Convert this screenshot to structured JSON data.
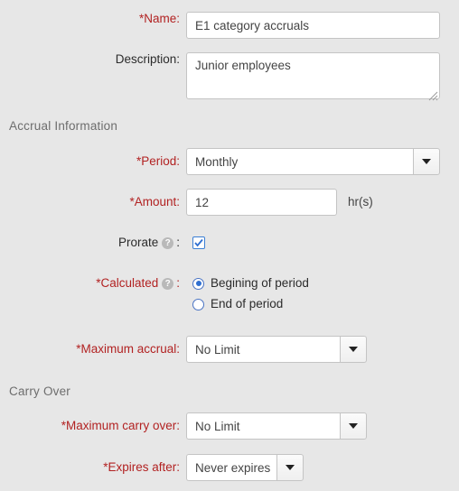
{
  "fields": {
    "name": {
      "label": "*Name:",
      "value": "E1 category accruals",
      "placeholder": ""
    },
    "description": {
      "label": "Description:",
      "value": "Junior employees",
      "placeholder": ""
    },
    "period": {
      "label": "*Period:",
      "value": "Monthly"
    },
    "amount": {
      "label": "*Amount:",
      "value": "12",
      "unit": "hr(s)",
      "placeholder": ""
    },
    "prorate": {
      "label": "Prorate",
      "colon": ":",
      "help": "?",
      "checked": true
    },
    "calculated": {
      "label": "*Calculated",
      "colon": ":",
      "help": "?",
      "options": [
        {
          "label": "Begining of period",
          "selected": true
        },
        {
          "label": "End of period",
          "selected": false
        }
      ]
    },
    "maximum_accrual": {
      "label": "*Maximum accrual:",
      "value": "No Limit"
    },
    "maximum_carry_over": {
      "label": "*Maximum carry over:",
      "value": "No Limit"
    },
    "expires_after": {
      "label": "*Expires after:",
      "value": "Never expires"
    }
  },
  "sections": {
    "accrual_information": "Accrual Information",
    "carry_over": "Carry Over"
  },
  "colors": {
    "background": "#e7e7e7",
    "required_label": "#b22222",
    "label": "#2b2b2b",
    "section_heading": "#6d6d6d",
    "input_border": "#c4c4c4",
    "accent_checkbox": "#3b7fd4",
    "accent_radio": "#2f6fd0",
    "help_icon_bg": "#b9b9b9"
  }
}
